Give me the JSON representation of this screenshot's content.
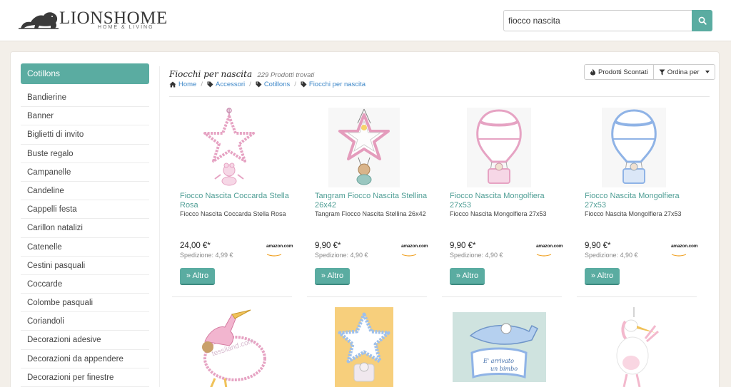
{
  "header": {
    "logo_text": "LIONSHOME",
    "logo_sub": "HOME & LIVING",
    "search_value": "fiocco nascita"
  },
  "sidebar": {
    "title": "Cotillons",
    "items": [
      "Bandierine",
      "Banner",
      "Biglietti di invito",
      "Buste regalo",
      "Campanelle",
      "Candeline",
      "Cappelli festa",
      "Carillon natalizi",
      "Catenelle",
      "Cestini pasquali",
      "Coccarde",
      "Colombe pasquali",
      "Coriandoli",
      "Decorazioni adesive",
      "Decorazioni da appendere",
      "Decorazioni per finestre"
    ]
  },
  "content": {
    "title": "Fiocchi per nascita",
    "count": "229 Prodotti trovati",
    "breadcrumb": [
      "Home",
      "Accessori",
      "Cotillons",
      "Fiocchi per nascita"
    ],
    "discount_label": "Prodotti Scontati",
    "sort_label": "Ordina per"
  },
  "products": [
    {
      "title": "Fiocco Nascita Coccarda Stella Rosa",
      "desc": "Fiocco Nascita Coccarda Stella Rosa",
      "price": "24,00 €*",
      "shipping": "Spedizione: 4,99 €",
      "button": "» Altro",
      "icon": "pink-star-bow-image"
    },
    {
      "title": "Tangram Fiocco Nascita Stellina 26x42",
      "desc": "Tangram Fiocco Nascita Stellina 26x42",
      "price": "9,90 €*",
      "shipping": "Spedizione: 4,90 €",
      "button": "» Altro",
      "icon": "star-teddy-bow-image"
    },
    {
      "title": "Fiocco Nascita Mongolfiera 27x53",
      "desc": "Fiocco Nascita Mongolfiera 27x53",
      "price": "9,90 €*",
      "shipping": "Spedizione: 4,90 €",
      "button": "» Altro",
      "icon": "pink-balloon-image"
    },
    {
      "title": "Fiocco Nascita Mongolfiera 27x53",
      "desc": "Fiocco Nascita Mongolfiera 27x53",
      "price": "9,90 €*",
      "shipping": "Spedizione: 4,90 €",
      "button": "» Altro",
      "icon": "blue-balloon-image"
    }
  ],
  "row2": {
    "watermark": "tessiland.com",
    "plane_text_1": "E' arrivato",
    "plane_text_2": "un bimbo"
  },
  "seller_label": "amazon.com",
  "colors": {
    "accent": "#5aaca1",
    "link": "#3d87c8",
    "pink": "#e6a3c3",
    "blue": "#8fb3e6"
  }
}
